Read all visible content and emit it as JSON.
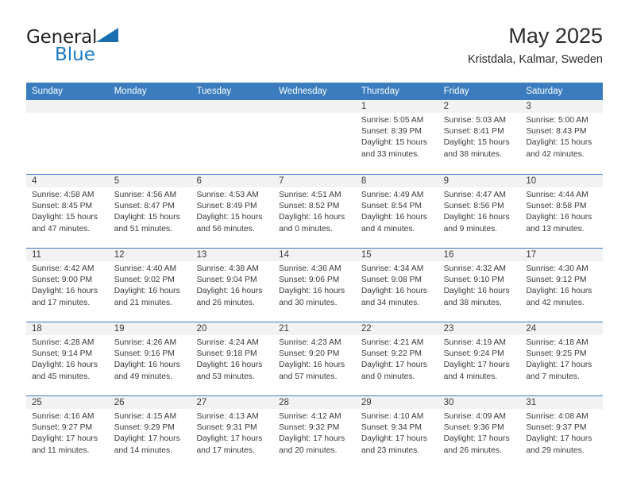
{
  "brand": {
    "name_part1": "General",
    "name_part2": "Blue",
    "triangle_color": "#1a6fb0",
    "blue_color": "#1a7ac4"
  },
  "header": {
    "title": "May 2025",
    "subtitle": "Kristdala, Kalmar, Sweden",
    "accent_color": "#3a7cbd"
  },
  "weekdays": [
    "Sunday",
    "Monday",
    "Tuesday",
    "Wednesday",
    "Thursday",
    "Friday",
    "Saturday"
  ],
  "labels": {
    "sunrise": "Sunrise:",
    "sunset": "Sunset:",
    "daylight": "Daylight:"
  },
  "weeks": [
    [
      {
        "day": "",
        "sunrise": "",
        "sunset": "",
        "daylight": ""
      },
      {
        "day": "",
        "sunrise": "",
        "sunset": "",
        "daylight": ""
      },
      {
        "day": "",
        "sunrise": "",
        "sunset": "",
        "daylight": ""
      },
      {
        "day": "",
        "sunrise": "",
        "sunset": "",
        "daylight": ""
      },
      {
        "day": "1",
        "sunrise": "Sunrise: 5:05 AM",
        "sunset": "Sunset: 8:39 PM",
        "daylight": "Daylight: 15 hours and 33 minutes."
      },
      {
        "day": "2",
        "sunrise": "Sunrise: 5:03 AM",
        "sunset": "Sunset: 8:41 PM",
        "daylight": "Daylight: 15 hours and 38 minutes."
      },
      {
        "day": "3",
        "sunrise": "Sunrise: 5:00 AM",
        "sunset": "Sunset: 8:43 PM",
        "daylight": "Daylight: 15 hours and 42 minutes."
      }
    ],
    [
      {
        "day": "4",
        "sunrise": "Sunrise: 4:58 AM",
        "sunset": "Sunset: 8:45 PM",
        "daylight": "Daylight: 15 hours and 47 minutes."
      },
      {
        "day": "5",
        "sunrise": "Sunrise: 4:56 AM",
        "sunset": "Sunset: 8:47 PM",
        "daylight": "Daylight: 15 hours and 51 minutes."
      },
      {
        "day": "6",
        "sunrise": "Sunrise: 4:53 AM",
        "sunset": "Sunset: 8:49 PM",
        "daylight": "Daylight: 15 hours and 56 minutes."
      },
      {
        "day": "7",
        "sunrise": "Sunrise: 4:51 AM",
        "sunset": "Sunset: 8:52 PM",
        "daylight": "Daylight: 16 hours and 0 minutes."
      },
      {
        "day": "8",
        "sunrise": "Sunrise: 4:49 AM",
        "sunset": "Sunset: 8:54 PM",
        "daylight": "Daylight: 16 hours and 4 minutes."
      },
      {
        "day": "9",
        "sunrise": "Sunrise: 4:47 AM",
        "sunset": "Sunset: 8:56 PM",
        "daylight": "Daylight: 16 hours and 9 minutes."
      },
      {
        "day": "10",
        "sunrise": "Sunrise: 4:44 AM",
        "sunset": "Sunset: 8:58 PM",
        "daylight": "Daylight: 16 hours and 13 minutes."
      }
    ],
    [
      {
        "day": "11",
        "sunrise": "Sunrise: 4:42 AM",
        "sunset": "Sunset: 9:00 PM",
        "daylight": "Daylight: 16 hours and 17 minutes."
      },
      {
        "day": "12",
        "sunrise": "Sunrise: 4:40 AM",
        "sunset": "Sunset: 9:02 PM",
        "daylight": "Daylight: 16 hours and 21 minutes."
      },
      {
        "day": "13",
        "sunrise": "Sunrise: 4:38 AM",
        "sunset": "Sunset: 9:04 PM",
        "daylight": "Daylight: 16 hours and 26 minutes."
      },
      {
        "day": "14",
        "sunrise": "Sunrise: 4:36 AM",
        "sunset": "Sunset: 9:06 PM",
        "daylight": "Daylight: 16 hours and 30 minutes."
      },
      {
        "day": "15",
        "sunrise": "Sunrise: 4:34 AM",
        "sunset": "Sunset: 9:08 PM",
        "daylight": "Daylight: 16 hours and 34 minutes."
      },
      {
        "day": "16",
        "sunrise": "Sunrise: 4:32 AM",
        "sunset": "Sunset: 9:10 PM",
        "daylight": "Daylight: 16 hours and 38 minutes."
      },
      {
        "day": "17",
        "sunrise": "Sunrise: 4:30 AM",
        "sunset": "Sunset: 9:12 PM",
        "daylight": "Daylight: 16 hours and 42 minutes."
      }
    ],
    [
      {
        "day": "18",
        "sunrise": "Sunrise: 4:28 AM",
        "sunset": "Sunset: 9:14 PM",
        "daylight": "Daylight: 16 hours and 45 minutes."
      },
      {
        "day": "19",
        "sunrise": "Sunrise: 4:26 AM",
        "sunset": "Sunset: 9:16 PM",
        "daylight": "Daylight: 16 hours and 49 minutes."
      },
      {
        "day": "20",
        "sunrise": "Sunrise: 4:24 AM",
        "sunset": "Sunset: 9:18 PM",
        "daylight": "Daylight: 16 hours and 53 minutes."
      },
      {
        "day": "21",
        "sunrise": "Sunrise: 4:23 AM",
        "sunset": "Sunset: 9:20 PM",
        "daylight": "Daylight: 16 hours and 57 minutes."
      },
      {
        "day": "22",
        "sunrise": "Sunrise: 4:21 AM",
        "sunset": "Sunset: 9:22 PM",
        "daylight": "Daylight: 17 hours and 0 minutes."
      },
      {
        "day": "23",
        "sunrise": "Sunrise: 4:19 AM",
        "sunset": "Sunset: 9:24 PM",
        "daylight": "Daylight: 17 hours and 4 minutes."
      },
      {
        "day": "24",
        "sunrise": "Sunrise: 4:18 AM",
        "sunset": "Sunset: 9:25 PM",
        "daylight": "Daylight: 17 hours and 7 minutes."
      }
    ],
    [
      {
        "day": "25",
        "sunrise": "Sunrise: 4:16 AM",
        "sunset": "Sunset: 9:27 PM",
        "daylight": "Daylight: 17 hours and 11 minutes."
      },
      {
        "day": "26",
        "sunrise": "Sunrise: 4:15 AM",
        "sunset": "Sunset: 9:29 PM",
        "daylight": "Daylight: 17 hours and 14 minutes."
      },
      {
        "day": "27",
        "sunrise": "Sunrise: 4:13 AM",
        "sunset": "Sunset: 9:31 PM",
        "daylight": "Daylight: 17 hours and 17 minutes."
      },
      {
        "day": "28",
        "sunrise": "Sunrise: 4:12 AM",
        "sunset": "Sunset: 9:32 PM",
        "daylight": "Daylight: 17 hours and 20 minutes."
      },
      {
        "day": "29",
        "sunrise": "Sunrise: 4:10 AM",
        "sunset": "Sunset: 9:34 PM",
        "daylight": "Daylight: 17 hours and 23 minutes."
      },
      {
        "day": "30",
        "sunrise": "Sunrise: 4:09 AM",
        "sunset": "Sunset: 9:36 PM",
        "daylight": "Daylight: 17 hours and 26 minutes."
      },
      {
        "day": "31",
        "sunrise": "Sunrise: 4:08 AM",
        "sunset": "Sunset: 9:37 PM",
        "daylight": "Daylight: 17 hours and 29 minutes."
      }
    ]
  ]
}
